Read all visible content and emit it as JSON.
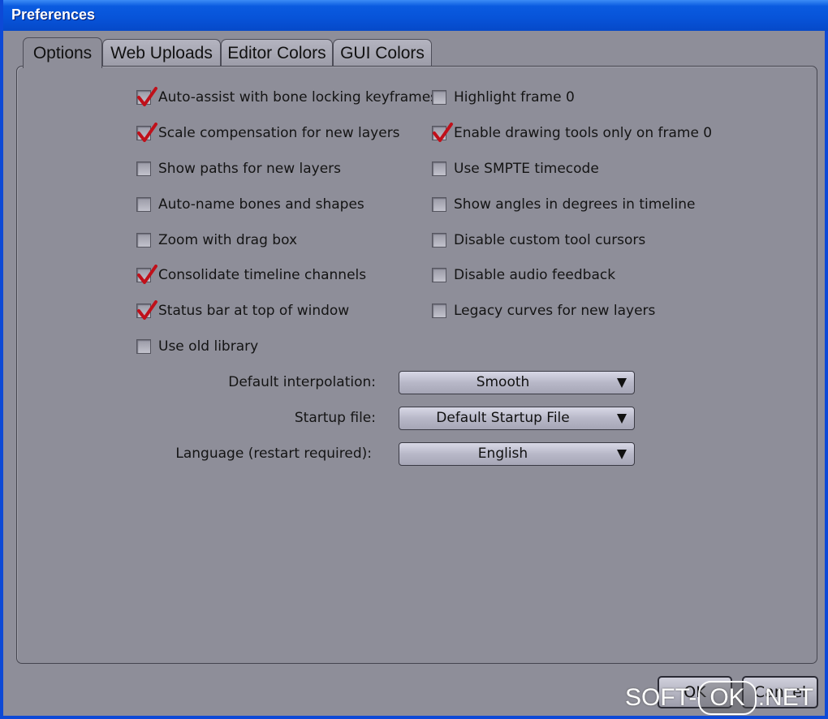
{
  "window": {
    "title": "Preferences"
  },
  "tabs": [
    {
      "label": "Options",
      "active": true
    },
    {
      "label": "Web Uploads",
      "active": false
    },
    {
      "label": "Editor Colors",
      "active": false
    },
    {
      "label": "GUI Colors",
      "active": false
    }
  ],
  "options": {
    "left": [
      {
        "label": "Auto-assist with bone locking keyframes",
        "checked": true
      },
      {
        "label": "Scale compensation for new layers",
        "checked": true
      },
      {
        "label": "Show paths for new layers",
        "checked": false
      },
      {
        "label": "Auto-name bones and shapes",
        "checked": false
      },
      {
        "label": "Zoom with drag box",
        "checked": false
      },
      {
        "label": "Consolidate timeline channels",
        "checked": true
      },
      {
        "label": "Status bar at top of window",
        "checked": true
      },
      {
        "label": "Use old library",
        "checked": false
      }
    ],
    "right": [
      {
        "label": "Highlight frame 0",
        "checked": false
      },
      {
        "label": "Enable drawing tools only on frame 0",
        "checked": true
      },
      {
        "label": "Use SMPTE timecode",
        "checked": false
      },
      {
        "label": "Show angles in degrees in timeline",
        "checked": false
      },
      {
        "label": "Disable custom tool cursors",
        "checked": false
      },
      {
        "label": "Disable audio feedback",
        "checked": false
      },
      {
        "label": "Legacy curves for new layers",
        "checked": false
      }
    ]
  },
  "form": {
    "interpolation": {
      "label": "Default interpolation:",
      "value": "Smooth"
    },
    "startup": {
      "label": "Startup file:",
      "value": "Default Startup File"
    },
    "language": {
      "label": "Language (restart required):",
      "value": "English"
    }
  },
  "buttons": {
    "ok": "OK",
    "cancel": "Cancel"
  },
  "watermark": {
    "left": "SOFT-",
    "mid": "OK",
    "right": ".NET"
  },
  "colors": {
    "check": "#c0101a",
    "titlebar": "#0753d8",
    "panel": "#8e8e99"
  }
}
